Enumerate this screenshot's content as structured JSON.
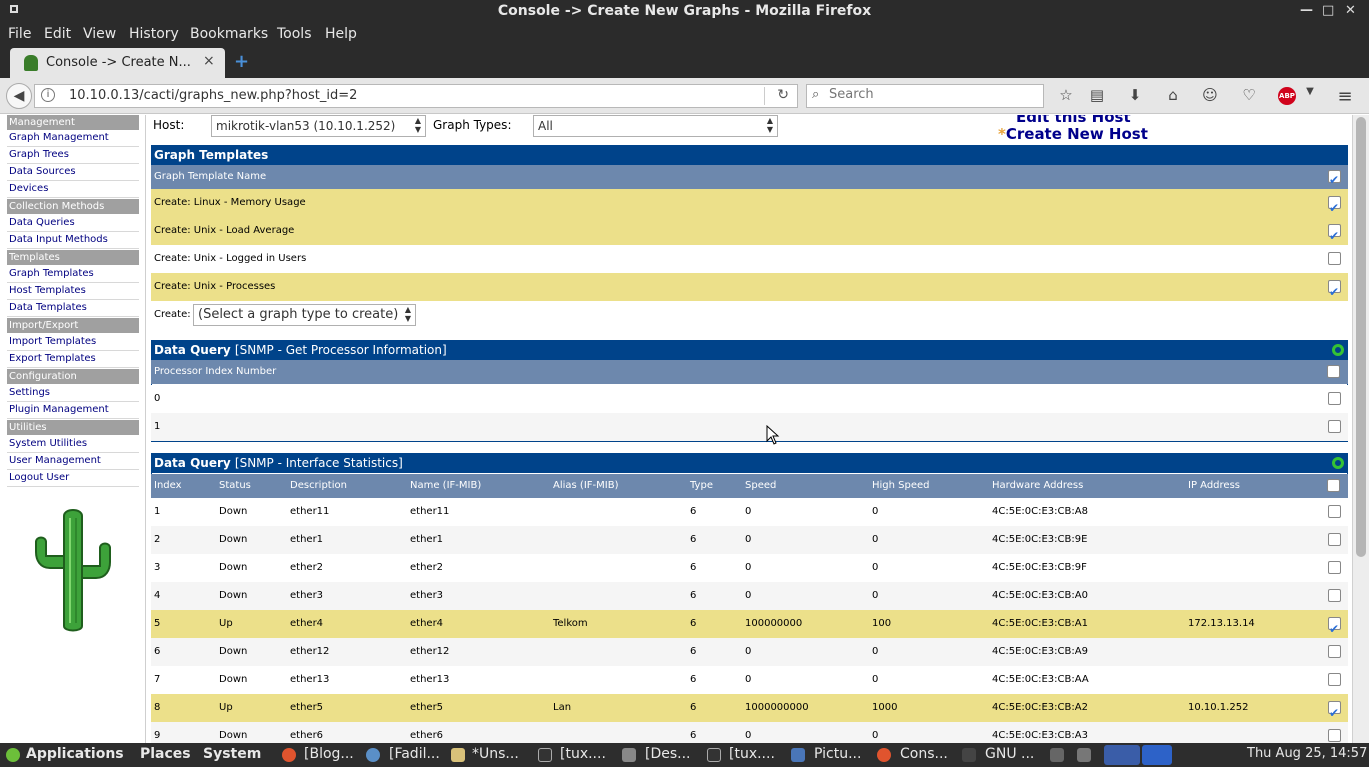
{
  "window": {
    "title": "Console -> Create New Graphs - Mozilla Firefox"
  },
  "menu": [
    "File",
    "Edit",
    "View",
    "History",
    "Bookmarks",
    "Tools",
    "Help"
  ],
  "tab": {
    "label": "Console -> Create N...",
    "close": "×",
    "new_tab": "+"
  },
  "nav": {
    "url": "10.10.0.13/cacti/graphs_new.php?host_id=2",
    "search_placeholder": "Search"
  },
  "sidebar": {
    "sections": [
      {
        "head": "Management",
        "items": [
          "Graph Management",
          "Graph Trees",
          "Data Sources",
          "Devices"
        ]
      },
      {
        "head": "Collection Methods",
        "items": [
          "Data Queries",
          "Data Input Methods"
        ]
      },
      {
        "head": "Templates",
        "items": [
          "Graph Templates",
          "Host Templates",
          "Data Templates"
        ]
      },
      {
        "head": "Import/Export",
        "items": [
          "Import Templates",
          "Export Templates"
        ]
      },
      {
        "head": "Configuration",
        "items": [
          "Settings",
          "Plugin Management"
        ]
      },
      {
        "head": "Utilities",
        "items": [
          "System Utilities",
          "User Management",
          "Logout User"
        ]
      }
    ]
  },
  "host_bar": {
    "host_label": "Host:",
    "host_value": "mikrotik-vlan53 (10.10.1.252)",
    "graph_types_label": "Graph Types:",
    "graph_types_value": "All",
    "edit_link": "Edit this Host",
    "create_link": "Create New Host",
    "star": "*"
  },
  "graph_templates": {
    "title": "Graph Templates",
    "column": "Graph Template Name",
    "rows": [
      {
        "name": "Create: Linux - Memory Usage",
        "checked": true
      },
      {
        "name": "Create: Unix - Load Average",
        "checked": true
      },
      {
        "name": "Create: Unix - Logged in Users",
        "checked": false
      },
      {
        "name": "Create: Unix - Processes",
        "checked": true
      }
    ],
    "create_label": "Create:",
    "create_select": "(Select a graph type to create)"
  },
  "dq_processor": {
    "title": "Data Query",
    "subtitle": "[SNMP - Get Processor Information]",
    "column": "Processor Index Number",
    "rows": [
      "0",
      "1"
    ]
  },
  "dq_interface": {
    "title": "Data Query",
    "subtitle": "[SNMP - Interface Statistics]",
    "columns": [
      "Index",
      "Status",
      "Description",
      "Name (IF-MIB)",
      "Alias (IF-MIB)",
      "Type",
      "Speed",
      "High Speed",
      "Hardware Address",
      "IP Address"
    ],
    "rows": [
      {
        "index": "1",
        "status": "Down",
        "desc": "ether11",
        "name": "ether11",
        "alias": "",
        "type": "6",
        "speed": "0",
        "high": "0",
        "hw": "4C:5E:0C:E3:CB:A8",
        "ip": "",
        "checked": false
      },
      {
        "index": "2",
        "status": "Down",
        "desc": "ether1",
        "name": "ether1",
        "alias": "",
        "type": "6",
        "speed": "0",
        "high": "0",
        "hw": "4C:5E:0C:E3:CB:9E",
        "ip": "",
        "checked": false
      },
      {
        "index": "3",
        "status": "Down",
        "desc": "ether2",
        "name": "ether2",
        "alias": "",
        "type": "6",
        "speed": "0",
        "high": "0",
        "hw": "4C:5E:0C:E3:CB:9F",
        "ip": "",
        "checked": false
      },
      {
        "index": "4",
        "status": "Down",
        "desc": "ether3",
        "name": "ether3",
        "alias": "",
        "type": "6",
        "speed": "0",
        "high": "0",
        "hw": "4C:5E:0C:E3:CB:A0",
        "ip": "",
        "checked": false
      },
      {
        "index": "5",
        "status": "Up",
        "desc": "ether4",
        "name": "ether4",
        "alias": "Telkom",
        "type": "6",
        "speed": "100000000",
        "high": "100",
        "hw": "4C:5E:0C:E3:CB:A1",
        "ip": "172.13.13.14",
        "checked": true
      },
      {
        "index": "6",
        "status": "Down",
        "desc": "ether12",
        "name": "ether12",
        "alias": "",
        "type": "6",
        "speed": "0",
        "high": "0",
        "hw": "4C:5E:0C:E3:CB:A9",
        "ip": "",
        "checked": false
      },
      {
        "index": "7",
        "status": "Down",
        "desc": "ether13",
        "name": "ether13",
        "alias": "",
        "type": "6",
        "speed": "0",
        "high": "0",
        "hw": "4C:5E:0C:E3:CB:AA",
        "ip": "",
        "checked": false
      },
      {
        "index": "8",
        "status": "Up",
        "desc": "ether5",
        "name": "ether5",
        "alias": "Lan",
        "type": "6",
        "speed": "1000000000",
        "high": "1000",
        "hw": "4C:5E:0C:E3:CB:A2",
        "ip": "10.10.1.252",
        "checked": true
      },
      {
        "index": "9",
        "status": "Down",
        "desc": "ether6",
        "name": "ether6",
        "alias": "",
        "type": "6",
        "speed": "0",
        "high": "0",
        "hw": "4C:5E:0C:E3:CB:A3",
        "ip": "",
        "checked": false
      }
    ]
  },
  "taskbar": {
    "applications": "Applications",
    "places": "Places",
    "system": "System",
    "tasks": [
      "[Blog...",
      "[Fadil...",
      "*Uns...",
      "[tux....",
      "[Des...",
      "[tux....",
      "Pictu...",
      "Cons...",
      "GNU ..."
    ],
    "clock": "Thu Aug 25, 14:57"
  },
  "colors": {
    "header_dark": "#00438a",
    "header_mid": "#6d88ad",
    "selected_row": "#ece08a",
    "link": "#00008b"
  }
}
